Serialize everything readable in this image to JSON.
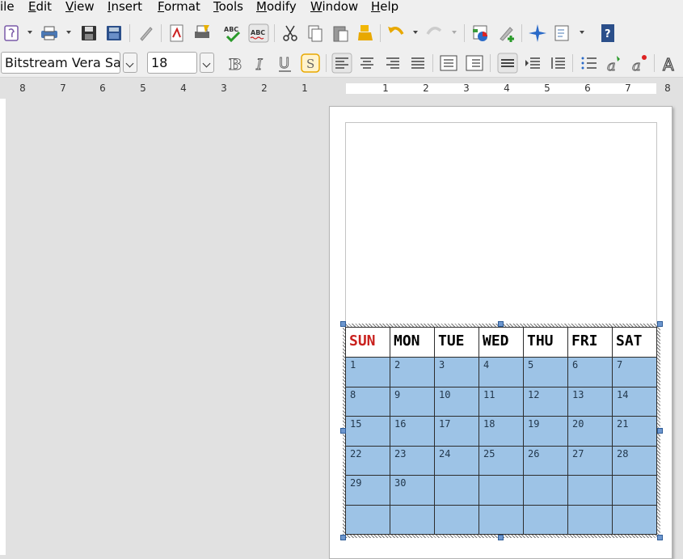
{
  "menu": {
    "items": [
      "ile",
      "Edit",
      "View",
      "Insert",
      "Format",
      "Tools",
      "Modify",
      "Window",
      "Help"
    ]
  },
  "toolbar": {
    "buttons": [
      "styles-icon",
      "print-icon",
      "save-icon",
      "save-all-icon",
      "edit-pen-icon",
      "export-pdf-icon",
      "print-direct-icon",
      "spellcheck-icon",
      "autospell-icon",
      "cut-icon",
      "copy-icon",
      "paste-icon",
      "clone-format-icon",
      "undo-icon",
      "redo-icon",
      "chart-icon",
      "gallery-icon",
      "navigator-icon",
      "page-layout-icon",
      "help-icon"
    ]
  },
  "format": {
    "font_name": "Bitstream Vera Sans",
    "font_size": "18"
  },
  "ruler": {
    "left_numbers": [
      "8",
      "7",
      "6",
      "5",
      "4",
      "3",
      "2",
      "1"
    ],
    "right_numbers": [
      "1",
      "2",
      "3",
      "4",
      "5",
      "6",
      "7",
      "8"
    ]
  },
  "calendar": {
    "days": [
      "SUN",
      "MON",
      "TUE",
      "WED",
      "THU",
      "FRI",
      "SAT"
    ],
    "weeks": [
      [
        "1",
        "2",
        "3",
        "4",
        "5",
        "6",
        "7"
      ],
      [
        "8",
        "9",
        "10",
        "11",
        "12",
        "13",
        "14"
      ],
      [
        "15",
        "16",
        "17",
        "18",
        "19",
        "20",
        "21"
      ],
      [
        "22",
        "23",
        "24",
        "25",
        "26",
        "27",
        "28"
      ],
      [
        "29",
        "30",
        "",
        "",
        "",
        "",
        ""
      ],
      [
        "",
        "",
        "",
        "",
        "",
        "",
        ""
      ]
    ],
    "sunday_color": "#c9211e",
    "cell_color": "#9dc3e6"
  }
}
